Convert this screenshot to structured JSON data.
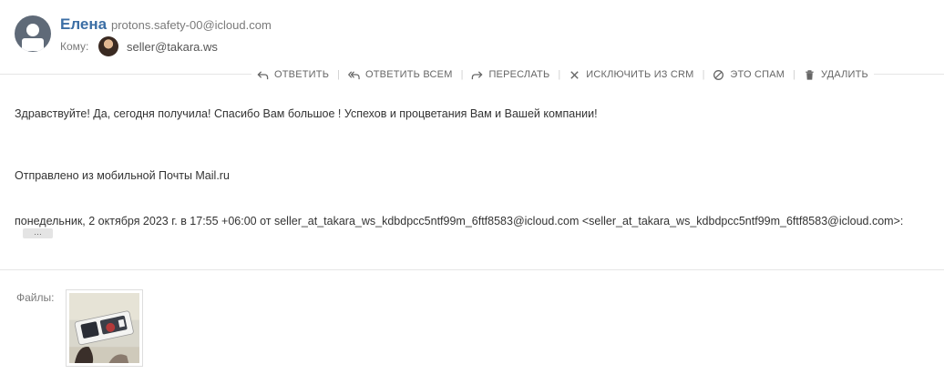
{
  "sender": {
    "name": "Елена",
    "email": "protons.safety-00@icloud.com",
    "avatar_icon": "user-silhouette-icon"
  },
  "recipient": {
    "label": "Кому:",
    "email": "seller@takara.ws"
  },
  "toolbar": {
    "actions": [
      {
        "label": "ОТВЕТИТЬ",
        "icon": "reply-icon"
      },
      {
        "label": "ОТВЕТИТЬ ВСЕМ",
        "icon": "reply-all-icon"
      },
      {
        "label": "ПЕРЕСЛАТЬ",
        "icon": "forward-icon"
      },
      {
        "label": "ИСКЛЮЧИТЬ ИЗ CRM",
        "icon": "close-icon"
      },
      {
        "label": "ЭТО СПАМ",
        "icon": "spam-icon"
      },
      {
        "label": "УДАЛИТЬ",
        "icon": "trash-icon"
      }
    ]
  },
  "message": {
    "body": "Здравствуйте! Да, сегодня получила! Спасибо Вам большое ! Успехов и процветания Вам и Вашей компании!",
    "signature": "Отправлено из мобильной Почты Mail.ru",
    "quote_header": "понедельник, 2 октября 2023 г. в 17:55 +06:00 от seller_at_takara_ws_kdbdpcc5ntf99m_6ftf8583@icloud.com <seller_at_takara_ws_kdbdpcc5ntf99m_6ftf8583@icloud.com>:",
    "expand_quote": "…"
  },
  "attachments": {
    "label": "Файлы:"
  },
  "colors": {
    "sender_name": "#3b6ea5",
    "muted_text": "#7a7a7a",
    "toolbar_text": "#666666",
    "avatar_bg": "#5f6a78"
  }
}
